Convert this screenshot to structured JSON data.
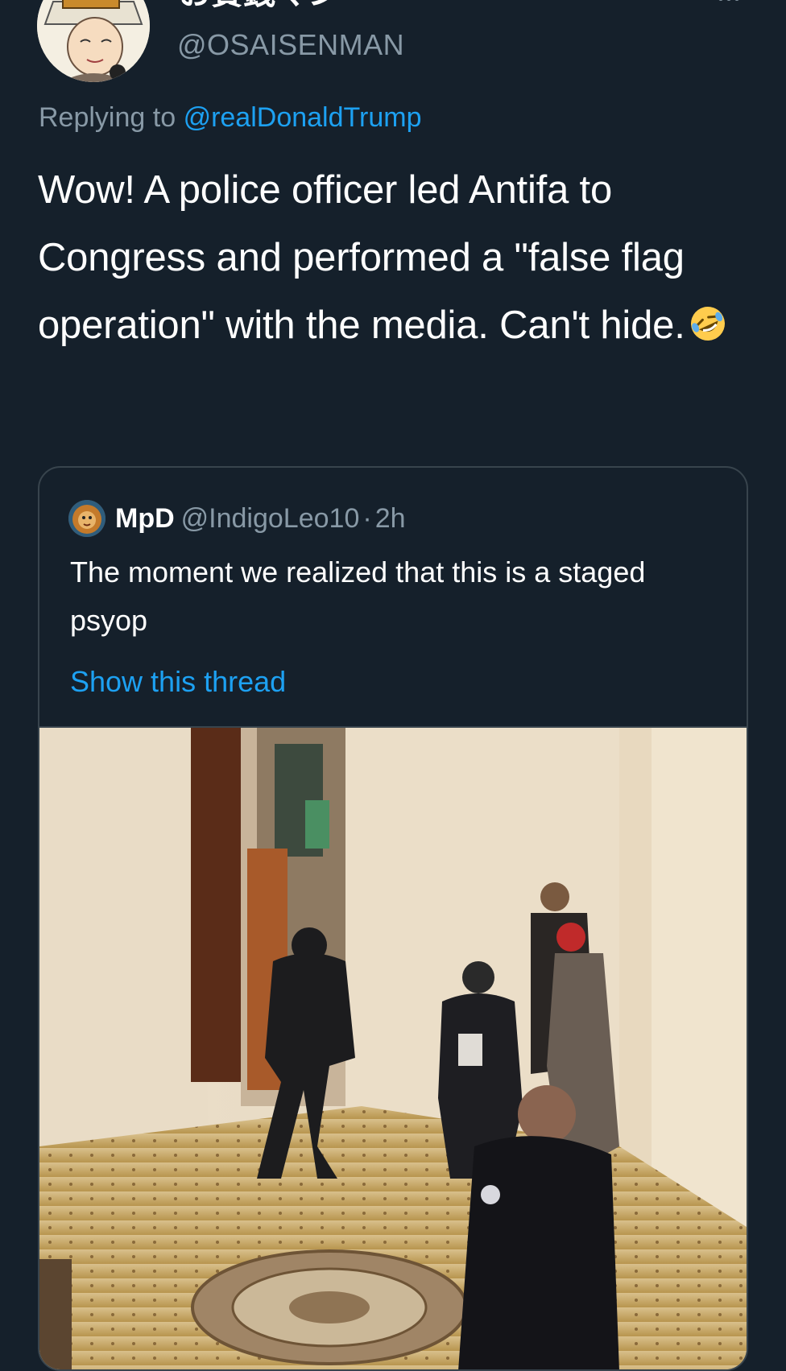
{
  "tweet": {
    "display_name": "お賽銭マン",
    "handle": "@OSAISENMAN",
    "reply_prefix": "Replying to",
    "reply_to": "@realDonaldTrump",
    "text": "Wow! A police officer led Antifa to Congress and performed a \"false flag operation\" with the media. Can't hide.",
    "emoji_icon": "rolling-on-floor-laughing-emoji"
  },
  "quoted_tweet": {
    "name": "MpD",
    "handle": "@IndigoLeo10",
    "separator": "·",
    "time": "2h",
    "text": "The moment we realized that this is a staged psyop",
    "show_thread": "Show this thread"
  },
  "colors": {
    "background": "#15202b",
    "text": "#ffffff",
    "secondary": "#8899a6",
    "link": "#1da1f2",
    "border": "#38444d"
  }
}
